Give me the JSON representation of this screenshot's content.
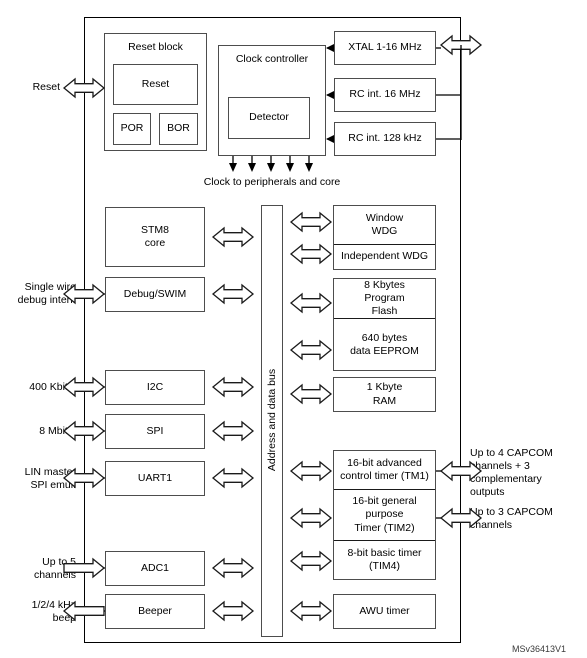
{
  "figure": {
    "id_label": "MSv36413V1"
  },
  "reset_block": {
    "title": "Reset block",
    "reset": "Reset",
    "por": "POR",
    "bor": "BOR",
    "external_label": "Reset"
  },
  "clock": {
    "title": "Clock controller",
    "detector": "Detector",
    "fanout_label": "Clock to peripherals and core",
    "sources": [
      {
        "label": "XTAL 1-16 MHz"
      },
      {
        "label": "RC int. 16 MHz"
      },
      {
        "label": "RC int. 128 kHz"
      }
    ]
  },
  "bus": {
    "label": "Address and data bus"
  },
  "left_blocks": [
    {
      "name": "stm8-core",
      "label": "STM8\ncore",
      "external": ""
    },
    {
      "name": "debug-swim",
      "label": "Debug/SWIM",
      "external": "Single wire\ndebug interf."
    },
    {
      "name": "i2c",
      "label": "I2C",
      "external": "400 Kbit/s"
    },
    {
      "name": "spi",
      "label": "SPI",
      "external": "8 Mbit/s"
    },
    {
      "name": "uart1",
      "label": "UART1",
      "external": "LIN master\nSPI emul."
    },
    {
      "name": "adc1",
      "label": "ADC1",
      "external": "Up to 5\nchannels"
    },
    {
      "name": "beeper",
      "label": "Beeper",
      "external": "1/2/4 kHz\nbeep"
    }
  ],
  "right_blocks": {
    "watchdogs": [
      {
        "name": "window-wdg",
        "label": "Window\nWDG"
      },
      {
        "name": "independent-wdg",
        "label": "Independent WDG"
      }
    ],
    "memory": [
      {
        "name": "program-flash",
        "label": "8 Kbytes\nProgram\nFlash"
      },
      {
        "name": "data-eeprom",
        "label": "640 bytes\ndata EEPROM"
      }
    ],
    "ram": {
      "name": "ram",
      "label": "1 Kbyte\nRAM"
    },
    "timers": [
      {
        "name": "tim1",
        "label": "16-bit advanced\ncontrol timer (TM1)",
        "external": "Up to 4 CAPCOM\nchannels + 3\ncomplementary\noutputs"
      },
      {
        "name": "tim2",
        "label": "16-bit general purpose\nTimer (TIM2)",
        "external": "Up to 3 CAPCOM\nchannels"
      },
      {
        "name": "tim4",
        "label": "8-bit basic timer\n(TIM4)",
        "external": ""
      }
    ],
    "awu": {
      "name": "awu-timer",
      "label": "AWU timer"
    }
  }
}
